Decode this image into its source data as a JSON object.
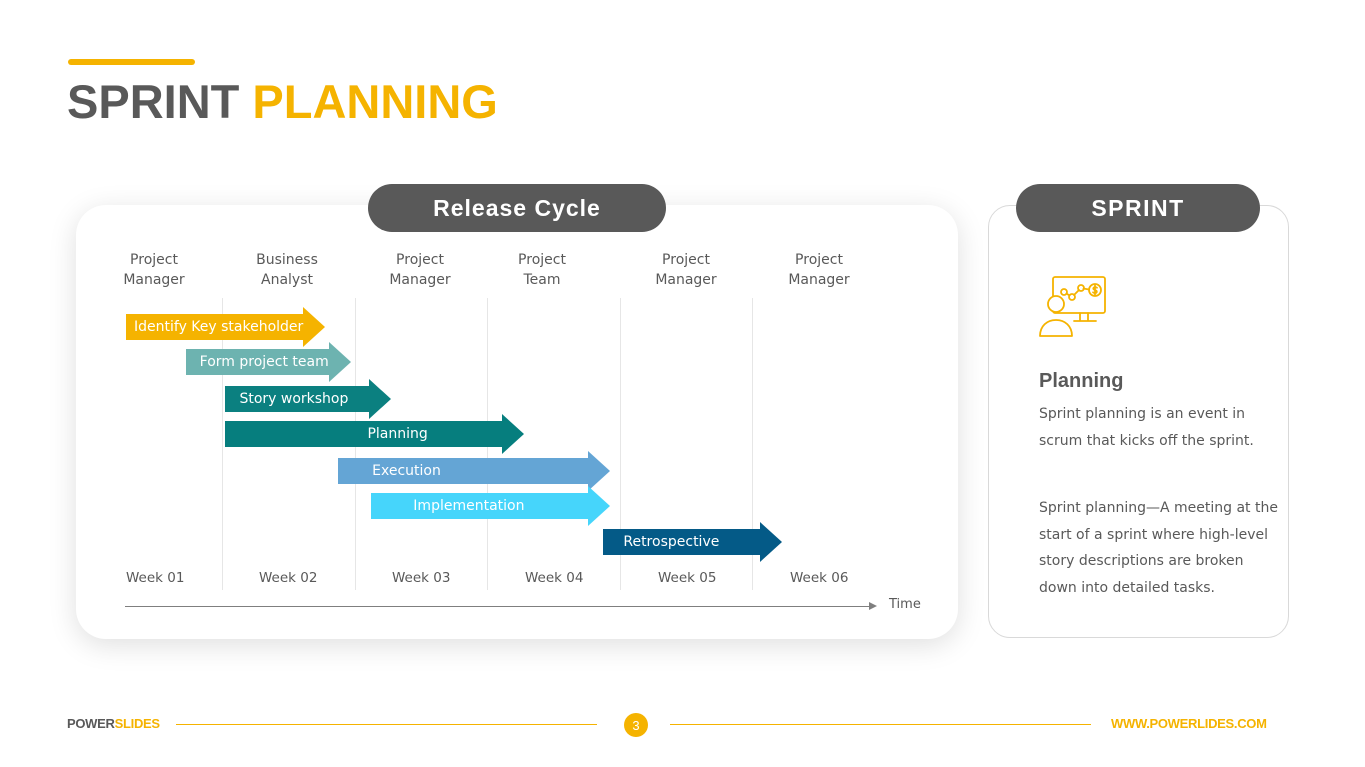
{
  "header": {
    "title_part1": "SPRINT",
    "title_part2": "PLANNING",
    "accent_color": "#F5B300",
    "dark_color": "#595959"
  },
  "release_cycle": {
    "title": "Release Cycle",
    "roles": [
      {
        "line1": "Project",
        "line2": "Manager"
      },
      {
        "line1": "Business",
        "line2": "Analyst"
      },
      {
        "line1": "Project",
        "line2": "Manager"
      },
      {
        "line1": "Project",
        "line2": "Team"
      },
      {
        "line1": "Project",
        "line2": "Manager"
      },
      {
        "line1": "Project",
        "line2": "Manager"
      }
    ],
    "weeks": [
      "Week 01",
      "Week 02",
      "Week 03",
      "Week 04",
      "Week 05",
      "Week 06"
    ],
    "axis_label": "Time",
    "tasks": [
      {
        "label": "Identify Key stakeholder",
        "start_week": 1.0,
        "end_week": 2.5,
        "color": "#F5B300"
      },
      {
        "label": "Form project team",
        "start_week": 1.45,
        "end_week": 2.7,
        "color": "#6DB3B0"
      },
      {
        "label": "Story workshop",
        "start_week": 1.75,
        "end_week": 3.0,
        "color": "#0B8080"
      },
      {
        "label": "Planning",
        "start_week": 1.75,
        "end_week": 4.0,
        "color": "#067E7E"
      },
      {
        "label": "Execution",
        "start_week": 2.6,
        "end_week": 4.65,
        "color": "#64A5D5"
      },
      {
        "label": "Implementation",
        "start_week": 2.85,
        "end_week": 4.65,
        "color": "#46D5FB"
      },
      {
        "label": "Retrospective",
        "start_week": 4.6,
        "end_week": 5.95,
        "color": "#045A87"
      }
    ]
  },
  "sprint_panel": {
    "title": "SPRINT",
    "icon": "presentation-analytics-icon",
    "heading": "Planning",
    "paragraph1": "Sprint planning is an event in scrum that kicks off the sprint.",
    "paragraph2": "Sprint planning—A meeting at the start of a sprint where high-level story descriptions are broken down into detailed tasks."
  },
  "footer": {
    "brand_part1": "POWER",
    "brand_part2": "SLIDES",
    "page_number": "3",
    "url": "WWW.POWERLIDES.COM"
  }
}
